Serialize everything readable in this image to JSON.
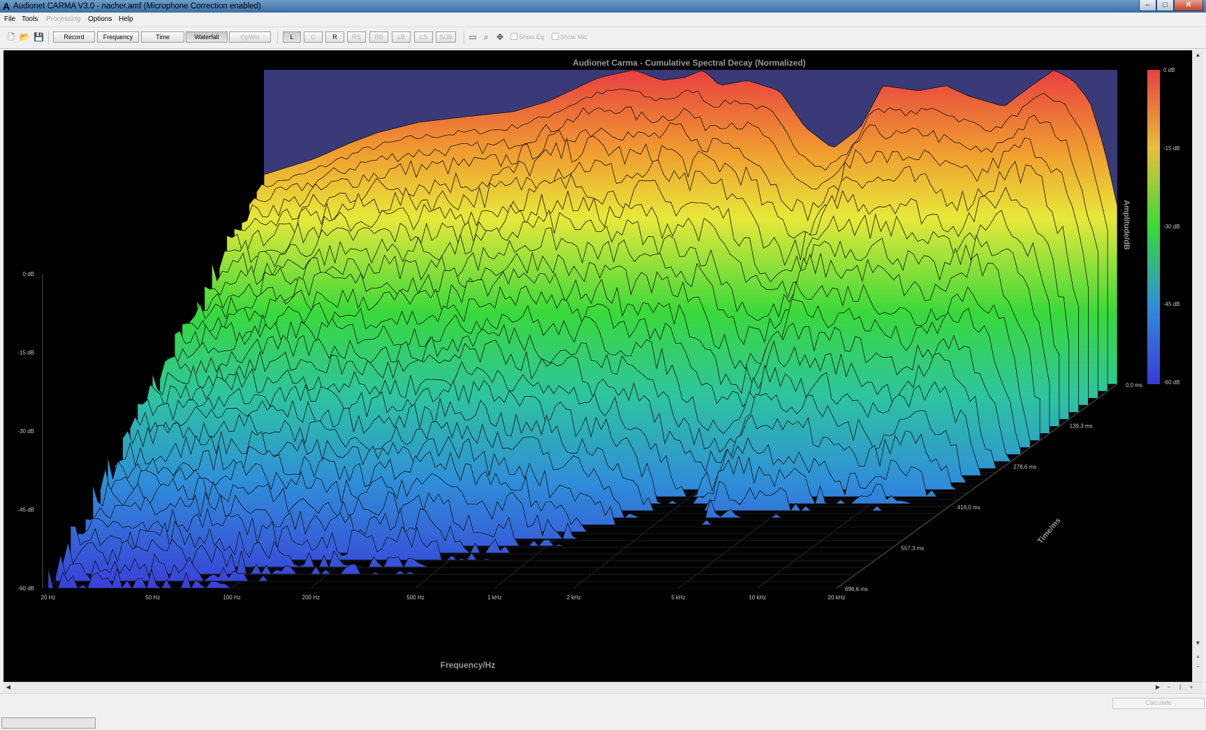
{
  "window": {
    "app_icon": "A",
    "title": "Audionet CARMA V3.0 - nacher.amf (Microphone Correction enabled)",
    "minimize": "–",
    "restore": "□",
    "close": "✕"
  },
  "menu": {
    "file": "File",
    "tools": "Tools",
    "processing": "Processing",
    "options": "Options",
    "help": "Help"
  },
  "toolbar": {
    "icons": [
      "new-file-icon",
      "open-folder-icon",
      "save-disk-icon"
    ],
    "view_buttons": [
      "Record",
      "Frequency",
      "Time",
      "Waterfall",
      "OpWin"
    ],
    "active_view": "Waterfall",
    "channels": [
      "L",
      "C",
      "R",
      "RS",
      "RB",
      "LB",
      "LS",
      "SUB"
    ],
    "enabled_channels": [
      "L",
      "R"
    ],
    "active_channel": "L",
    "show_eq": "Show Eq",
    "show_mic": "Show Mic"
  },
  "chart": {
    "title": "Audionet Carma - Cumulative Spectral Decay (Normalized)",
    "xlabel": "Frequency/Hz",
    "ylabel": "Amplitude/dB",
    "zlabel": "Time/ms",
    "x_ticks": [
      "20 Hz",
      "50 Hz",
      "100 Hz",
      "200 Hz",
      "500 Hz",
      "1 kHz",
      "2 kHz",
      "5 kHz",
      "10 kHz",
      "20 kHz"
    ],
    "y_ticks": [
      "0 dB",
      "-15 dB",
      "-30 dB",
      "-45 dB",
      "-60 dB"
    ],
    "z_ticks": [
      "0,0 ms",
      "139,3 ms",
      "278,6 ms",
      "418,0 ms",
      "557,3 ms",
      "696,6 ms"
    ],
    "colorbar_ticks": [
      "0 dB",
      "-15 dB",
      "-30 dB",
      "-45 dB",
      "-60 dB"
    ]
  },
  "chart_data": {
    "type": "waterfall",
    "title": "Audionet Carma - Cumulative Spectral Decay (Normalized)",
    "xlabel": "Frequency/Hz",
    "ylabel": "Amplitude/dB",
    "zlabel": "Time/ms",
    "x_scale": "log",
    "xlim": [
      20,
      20000
    ],
    "ylim": [
      -60,
      0
    ],
    "zlim": [
      0,
      696.6
    ],
    "slices": 30,
    "frequencies": [
      20,
      30,
      40,
      50,
      70,
      100,
      150,
      200,
      300,
      400,
      500,
      600,
      700,
      800,
      1000,
      1300,
      1600,
      2000,
      2500,
      3000,
      4000,
      5000,
      6000,
      8000,
      10000,
      12000,
      14000,
      16000,
      18000,
      20000
    ],
    "front_spectrum_db": [
      -20,
      -17,
      -14,
      -12,
      -10,
      -9,
      -8,
      -6,
      -1.5,
      0,
      -2,
      -1.5,
      0,
      -3,
      -2,
      -4,
      -11,
      -15,
      -11,
      -3,
      -4,
      -3,
      -5,
      -7,
      -3,
      0,
      -2,
      -6,
      -15,
      -26
    ],
    "colormap": [
      "#3a3ad8",
      "#2ec4ff",
      "#39d93a",
      "#e8e83a",
      "#f0a030",
      "#e04040"
    ],
    "background_colors": {
      "plot": "#000000",
      "back_panel": "#3a3a78"
    }
  },
  "statusbar": {
    "calculate": "Calculate"
  }
}
